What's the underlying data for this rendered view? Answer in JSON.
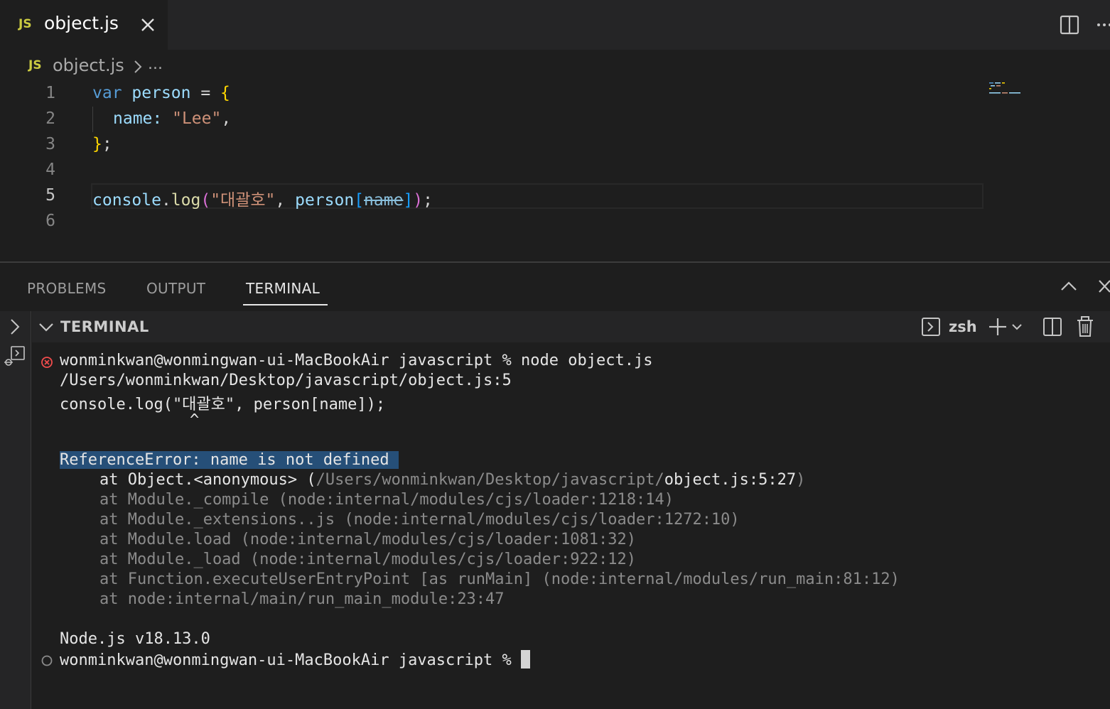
{
  "tab": {
    "badge": "JS",
    "filename": "object.js"
  },
  "breadcrumb": {
    "badge": "JS",
    "file": "object.js",
    "more": "..."
  },
  "editor": {
    "line_numbers": [
      "1",
      "2",
      "3",
      "4",
      "5",
      "6"
    ],
    "active_line": "5",
    "code": {
      "l1": {
        "kw": "var",
        "name": "person",
        "eq": " = ",
        "brace": "{"
      },
      "l2": {
        "key": "name: ",
        "val": "\"Lee\"",
        "comma": ","
      },
      "l3": {
        "brace": "}",
        "semi": ";"
      },
      "l5": {
        "obj": "console",
        "dot": ".",
        "fn": "log",
        "open": "(",
        "str": "\"대괄호\"",
        "comma": ", ",
        "obj2": "person",
        "lb": "[",
        "idx": "name",
        "rb": "]",
        "close": ")",
        "semi": ";"
      }
    }
  },
  "panel": {
    "tabs": [
      "PROBLEMS",
      "OUTPUT",
      "TERMINAL"
    ],
    "active_tab": "TERMINAL",
    "terminal_header": "TERMINAL",
    "shell": "zsh"
  },
  "terminal": {
    "cmd_line": "wonminkwan@wonmingwan-ui-MacBookAir javascript % node object.js",
    "path_line": "/Users/wonminkwan/Desktop/javascript/object.js:5",
    "code_line": "console.log(\"대괄호\", person[name]);",
    "caret_line": "                  ^",
    "error": "ReferenceError: name is not defined",
    "stack": [
      {
        "pre": "at Object.<anonymous> (",
        "dim": "/Users/wonminkwan/Desktop/javascript/",
        "file": "object.js:5:27",
        "post": ")"
      },
      {
        "text": "at Module._compile (node:internal/modules/cjs/loader:1218:14)"
      },
      {
        "text": "at Module._extensions..js (node:internal/modules/cjs/loader:1272:10)"
      },
      {
        "text": "at Module.load (node:internal/modules/cjs/loader:1081:32)"
      },
      {
        "text": "at Module._load (node:internal/modules/cjs/loader:922:12)"
      },
      {
        "text": "at Function.executeUserEntryPoint [as runMain] (node:internal/modules/run_main:81:12)"
      },
      {
        "text": "at node:internal/main/run_main_module:23:47"
      }
    ],
    "node_version": "Node.js v18.13.0",
    "prompt": "wonminkwan@wonmingwan-ui-MacBookAir javascript % "
  },
  "colors": {
    "error_dot": "#f14c4c",
    "selection": "#264f78",
    "js_badge": "#cbcb41"
  },
  "icons": [
    "close-icon",
    "split-editor-icon",
    "more-actions-icon",
    "chevron-right-icon",
    "chevron-up-icon",
    "chevron-down-icon",
    "launch-profile-icon",
    "plus-icon",
    "split-terminal-icon",
    "trash-icon",
    "error-circle-icon",
    "circle-icon"
  ]
}
